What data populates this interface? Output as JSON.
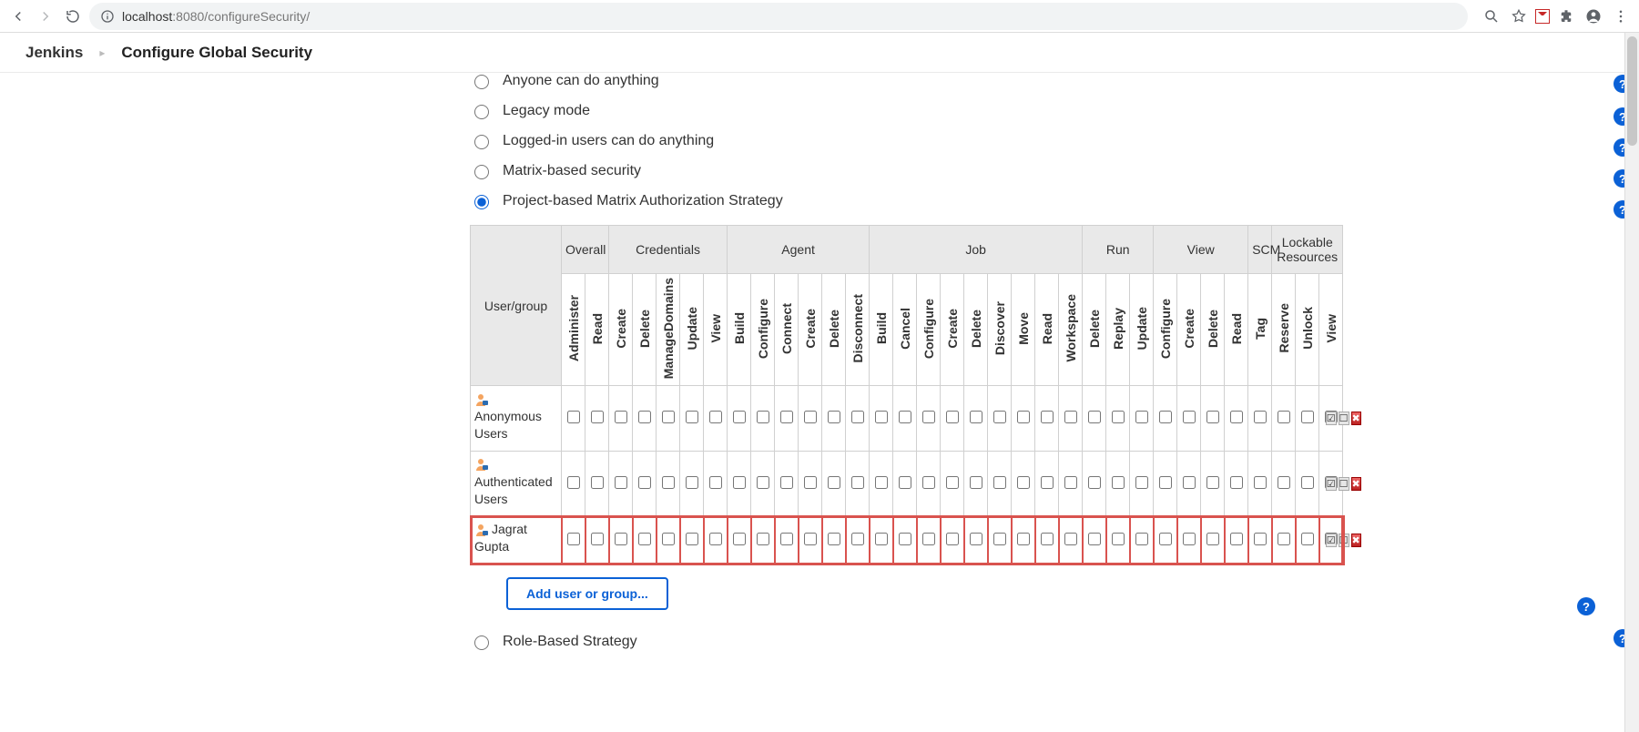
{
  "browser": {
    "url_prefix": "localhost",
    "url_suffix": ":8080/configureSecurity/"
  },
  "breadcrumb": {
    "root": "Jenkins",
    "current": "Configure Global Security"
  },
  "options": {
    "opt0": "Anyone can do anything",
    "opt1": "Legacy mode",
    "opt2": "Logged-in users can do anything",
    "opt3": "Matrix-based security",
    "opt4": "Project-based Matrix Authorization Strategy",
    "opt5": "Role-Based Strategy",
    "selected": "opt4"
  },
  "table": {
    "user_group_header": "User/group",
    "groups": {
      "overall": "Overall",
      "credentials": "Credentials",
      "agent": "Agent",
      "job": "Job",
      "run": "Run",
      "view": "View",
      "scm": "SCM",
      "lockable": "Lockable Resources"
    },
    "cols": {
      "c0": "Administer",
      "c1": "Read",
      "c2": "Create",
      "c3": "Delete",
      "c4": "ManageDomains",
      "c5": "Update",
      "c6": "View",
      "c7": "Build",
      "c8": "Configure",
      "c9": "Connect",
      "c10": "Create",
      "c11": "Delete",
      "c12": "Disconnect",
      "c13": "Build",
      "c14": "Cancel",
      "c15": "Configure",
      "c16": "Create",
      "c17": "Delete",
      "c18": "Discover",
      "c19": "Move",
      "c20": "Read",
      "c21": "Workspace",
      "c22": "Delete",
      "c23": "Replay",
      "c24": "Update",
      "c25": "Configure",
      "c26": "Create",
      "c27": "Delete",
      "c28": "Read",
      "c29": "Tag",
      "c30": "Reserve",
      "c31": "Unlock",
      "c32": "View"
    },
    "rows": {
      "r0": "Anonymous Users",
      "r1": "Authenticated Users",
      "r2": "Jagrat Gupta"
    }
  },
  "buttons": {
    "add": "Add user or group..."
  }
}
